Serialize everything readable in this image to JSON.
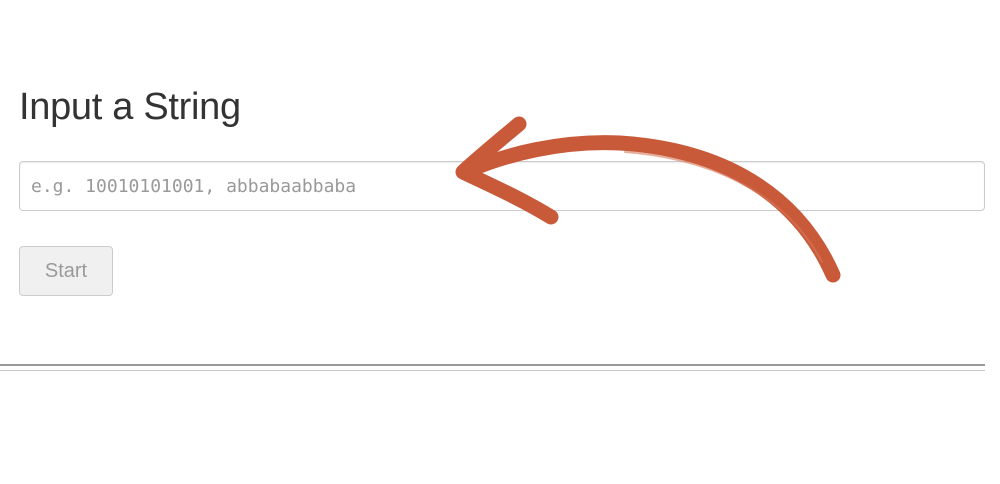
{
  "form": {
    "title": "Input a String",
    "input_placeholder": "e.g. 10010101001, abbabaabbaba",
    "input_value": "",
    "start_label": "Start"
  },
  "annotation": {
    "arrow_color": "#c85a3a",
    "arrow_icon": "curved-arrow-icon"
  },
  "colors": {
    "title": "#333333",
    "input_border": "#cccccc",
    "placeholder": "#999999",
    "button_bg": "#f0f0f0",
    "button_text": "#9a9a9a",
    "divider": "#999999"
  }
}
